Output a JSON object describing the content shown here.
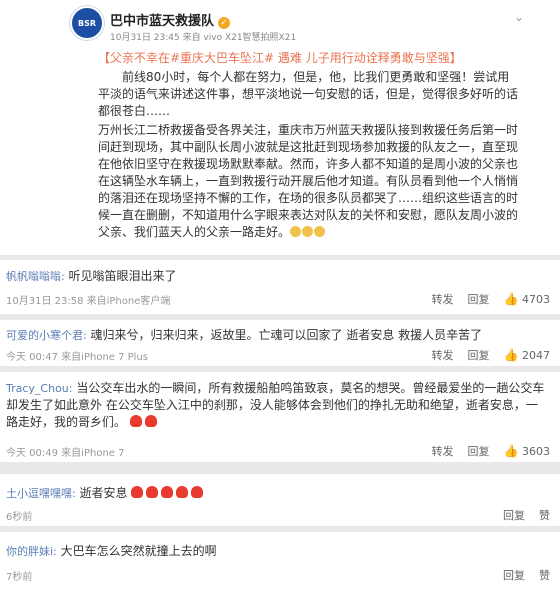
{
  "post": {
    "avatar_text": "BSR",
    "author": "巴中市蓝天救援队",
    "meta": "10月31日 23:45 来自 vivo X21智慧拍照X21",
    "body_line1": "【父亲不幸在#重庆大巴车坠江# 遇难 儿子用行动诠释勇敢与坚强】",
    "body_para1": "前线80小时，每个人都在努力，但是，他，比我们更勇敢和坚强！尝试用平淡的语气来讲述这件事，想平淡地说一句安慰的话，但是，觉得很多好听的话都很苍白……",
    "body_para2": "万州长江二桥救援备受各界关注，重庆市万州蓝天救援队接到救援任务后第一时间赶到现场，其中副队长周小波就是这批赶到现场参加救援的队友之一，直至现在他依旧坚守在救援现场默默奉献。然而，许多人都不知道的是周小波的父亲也在这辆坠水车辆上，一直到救援行动开展后他才知道。有队员看到他一个人悄悄的落泪还在现场坚持不懈的工作，在场的很多队员都哭了……组织这些语言的时候一直在删删，不知道用什么字眼来表达对队友的关怀和安慰，愿队友周小波的父亲、我们蓝天人的父亲一路走好。"
  },
  "comments": [
    {
      "name": "帆帆嗡嗡嗡:",
      "text": "听见嗡笛眼泪出来了",
      "time": "10月31日 23:58 来自iPhone客户端",
      "forward": "转发",
      "reply": "回复",
      "likes": "4703"
    },
    {
      "name": "可爱的小寒个君:",
      "text": "魂归来兮，归来归来，返故里。亡魂可以回家了 逝者安息 救援人员辛苦了",
      "time": "今天 00:47 来自iPhone 7 Plus",
      "forward": "转发",
      "reply": "回复",
      "likes": "2047"
    },
    {
      "name": "Tracy_Chou:",
      "text": "当公交车出水的一瞬间，所有救援船舶鸣笛致哀，莫名的想哭。曾经最爱坐的一趟公交车却发生了如此意外 在公交车坠入江中的刹那，没人能够体会到他们的挣扎无助和绝望，逝者安息，一路走好，我的哥乡们。",
      "time": "今天 00:49 来自iPhone 7",
      "forward": "转发",
      "reply": "回复",
      "likes": "3603"
    },
    {
      "name": "土小逗嘿嘿嘿:",
      "text": "逝者安息",
      "time": "6秒前",
      "reply": "回复",
      "likes": "赞"
    },
    {
      "name": "你的胖妹i:",
      "text": "大巴车怎么突然就撞上去的啊",
      "time": "7秒前",
      "reply": "回复",
      "likes": "赞"
    }
  ]
}
